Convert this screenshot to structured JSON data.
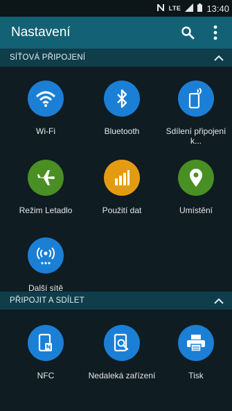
{
  "status_bar": {
    "network_label": "LTE",
    "time": "13:40"
  },
  "app_bar": {
    "title": "Nastavení",
    "search_icon": "search-icon",
    "menu_icon": "more-vert-icon"
  },
  "sections": [
    {
      "title": "SÍŤOVÁ PŘIPOJENÍ",
      "items": [
        {
          "label": "Wi-Fi",
          "icon": "wifi-icon",
          "color": "#1b7fd6"
        },
        {
          "label": "Bluetooth",
          "icon": "bluetooth-icon",
          "color": "#1b7fd6"
        },
        {
          "label": "Sdílení připojení k...",
          "icon": "tethering-icon",
          "color": "#1b7fd6"
        },
        {
          "label": "Režim Letadlo",
          "icon": "airplane-icon",
          "color": "#4a8f23"
        },
        {
          "label": "Použití dat",
          "icon": "data-usage-icon",
          "color": "#e39c12"
        },
        {
          "label": "Umístění",
          "icon": "location-icon",
          "color": "#4a8f23"
        },
        {
          "label": "Další sítě",
          "icon": "more-networks-icon",
          "color": "#1b7fd6"
        }
      ]
    },
    {
      "title": "PŘIPOJIT A SDÍLET",
      "items": [
        {
          "label": "NFC",
          "icon": "nfc-icon",
          "color": "#1b7fd6"
        },
        {
          "label": "Nedaleká zařízení",
          "icon": "nearby-devices-icon",
          "color": "#1b7fd6"
        },
        {
          "label": "Tisk",
          "icon": "print-icon",
          "color": "#1b7fd6"
        }
      ]
    }
  ]
}
